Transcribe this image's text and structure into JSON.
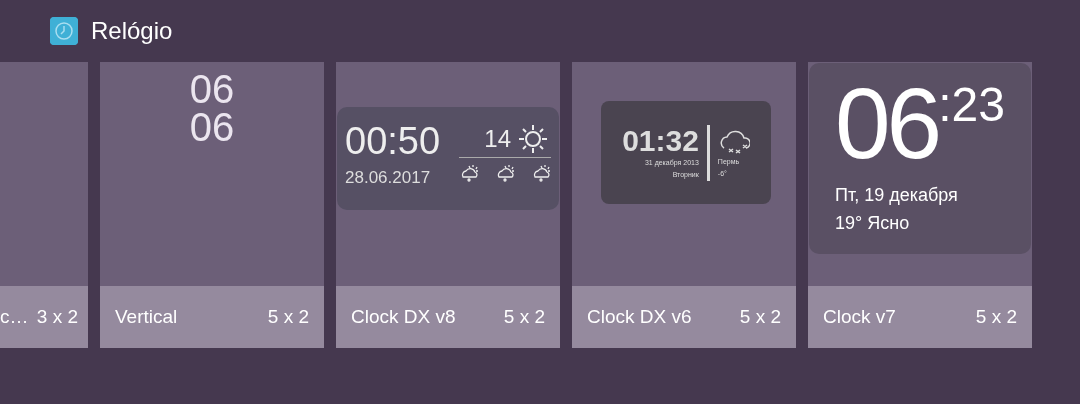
{
  "header": {
    "title": "Relógio"
  },
  "widgets": [
    {
      "title": "c…",
      "size": "3 x 2",
      "preview": {
        "kind": "blank"
      }
    },
    {
      "title": "Vertical",
      "size": "5 x 2",
      "preview": {
        "kind": "vertical",
        "hours": "06",
        "minutes": "06"
      }
    },
    {
      "title": "Clock DX v8",
      "size": "5 x 2",
      "preview": {
        "kind": "dx8",
        "time": "00:50",
        "date": "28.06.2017",
        "temperature": "14"
      }
    },
    {
      "title": "Clock DX v6",
      "size": "5 x 2",
      "preview": {
        "kind": "dx6",
        "time": "01:32",
        "date": "31 декабря 2013",
        "weekday": "Вторник",
        "city": "Пермь",
        "temperature": "-6°"
      }
    },
    {
      "title": "Clock v7",
      "size": "5 x 2",
      "preview": {
        "kind": "v7",
        "hours": "06",
        "minutes": ":23",
        "date": "Пт, 19 декабря",
        "weather": "19° Ясно"
      }
    }
  ]
}
